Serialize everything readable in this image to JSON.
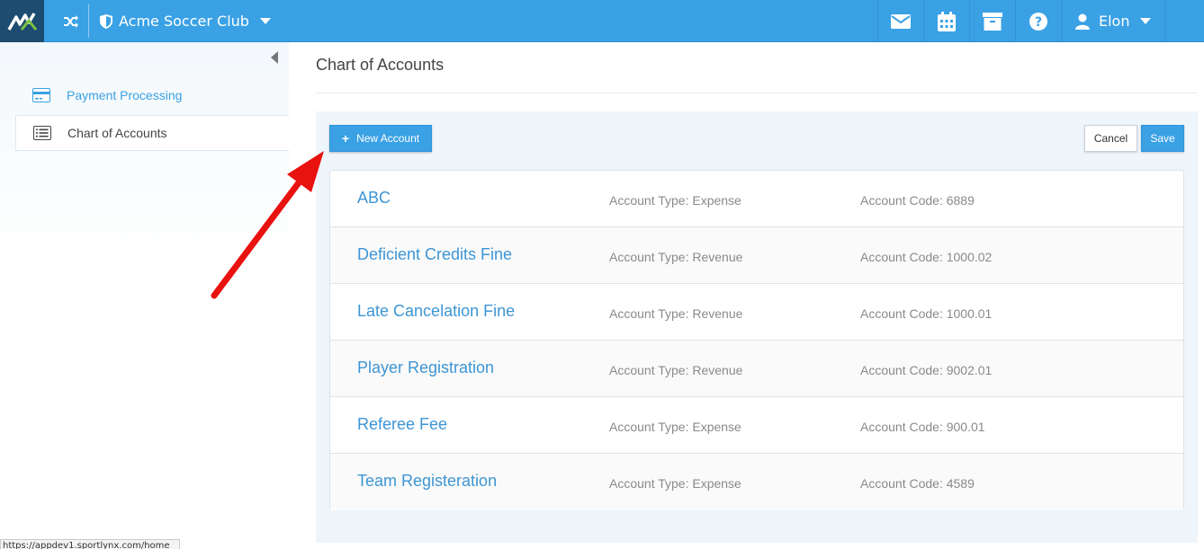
{
  "topbar": {
    "club_name": "Acme Soccer Club",
    "user_name": "Elon",
    "brand_color": "#3aa1e5",
    "icons": [
      "logo-icon",
      "shuffle-icon",
      "shield-icon",
      "envelope-icon",
      "calendar-icon",
      "archive-icon",
      "help-icon",
      "user-icon"
    ]
  },
  "sidebar": {
    "items": [
      {
        "label": "Payment Processing",
        "icon": "credit-card-icon",
        "active": false
      },
      {
        "label": "Chart of Accounts",
        "icon": "list-icon",
        "active": true
      }
    ]
  },
  "main": {
    "title": "Chart of Accounts",
    "new_account_label": "New Account",
    "cancel_label": "Cancel",
    "save_label": "Save",
    "accounts": [
      {
        "name": "ABC",
        "type": "Account Type: Expense",
        "code": "Account Code: 6889"
      },
      {
        "name": "Deficient Credits Fine",
        "type": "Account Type: Revenue",
        "code": "Account Code: 1000.02"
      },
      {
        "name": "Late Cancelation Fine",
        "type": "Account Type: Revenue",
        "code": "Account Code: 1000.01"
      },
      {
        "name": "Player Registration",
        "type": "Account Type: Revenue",
        "code": "Account Code: 9002.01"
      },
      {
        "name": "Referee Fee",
        "type": "Account Type: Expense",
        "code": "Account Code: 900.01"
      },
      {
        "name": "Team Registeration",
        "type": "Account Type: Expense",
        "code": "Account Code: 4589"
      }
    ]
  },
  "statusbar": {
    "url": "https://appdev1.sportlynx.com/home"
  },
  "annotation": {
    "arrow_color": "#e8120f"
  }
}
